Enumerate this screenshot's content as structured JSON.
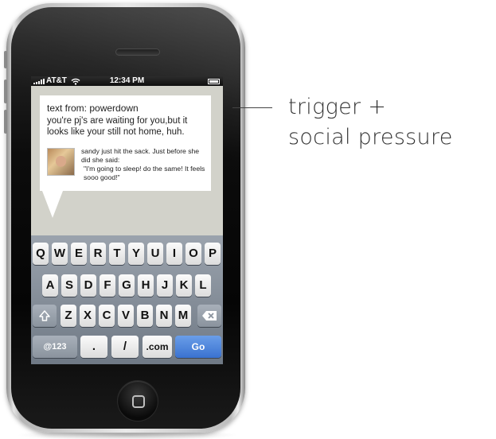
{
  "status_bar": {
    "carrier": "AT&T",
    "wifi_icon": "wifi-icon",
    "time": "12:34 PM",
    "battery_icon": "battery-icon"
  },
  "message": {
    "header": "text from: powerdown",
    "body": "you're pj's are waiting for you,but it looks like your still not home, huh.",
    "friend_line": "sandy just hit the sack. Just before she did she said:",
    "friend_quote": "\"I'm going to sleep! do the same! It feels sooo good!\"",
    "avatar_icon": "friend-avatar"
  },
  "keyboard": {
    "row1": [
      "Q",
      "W",
      "E",
      "R",
      "T",
      "Y",
      "U",
      "I",
      "O",
      "P"
    ],
    "row2": [
      "A",
      "S",
      "D",
      "F",
      "G",
      "H",
      "J",
      "K",
      "L"
    ],
    "row3": [
      "Z",
      "X",
      "C",
      "V",
      "B",
      "N",
      "M"
    ],
    "shift_icon": "shift-arrow-icon",
    "backspace_icon": "backspace-icon",
    "numbers_label": "@123",
    "dot_label": ".",
    "slash_label": "/",
    "dotcom_label": ".com",
    "go_label": "Go"
  },
  "annotation": {
    "line1": "trigger +",
    "line2": "social pressure"
  },
  "colors": {
    "go_key": "#3a72d0",
    "screen_background": "#d2d2ca"
  }
}
